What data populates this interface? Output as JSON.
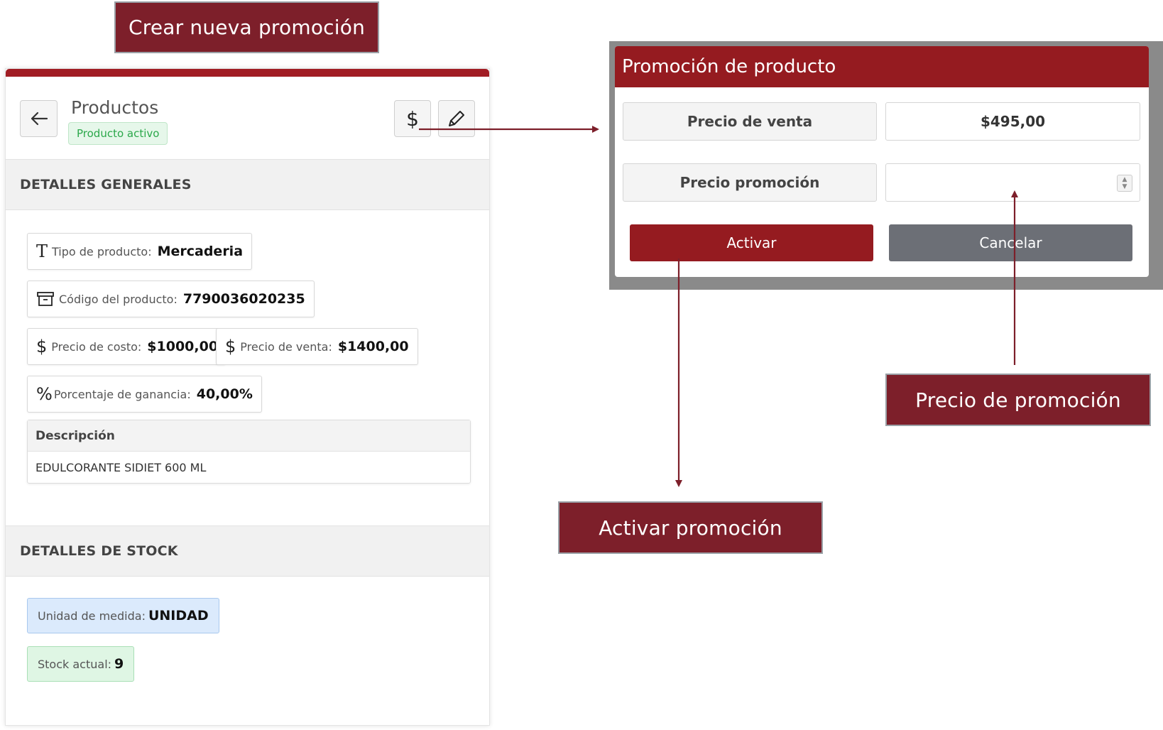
{
  "callouts": {
    "create": "Crear nueva promoción",
    "price": "Precio de promoción",
    "activate": "Activar promoción"
  },
  "colors": {
    "brand": "#951b20",
    "callout": "#7d1f2a",
    "cancel": "#6c6f76"
  },
  "product": {
    "title": "Productos",
    "status_badge": "Producto activo",
    "back_icon": "arrow-left-icon",
    "promo_icon": "dollar-icon",
    "edit_icon": "pencil-icon"
  },
  "general": {
    "heading": "DETALLES GENERALES",
    "tipo_label": "Tipo de producto:",
    "tipo_value": "Mercaderia",
    "codigo_label": "Código del producto:",
    "codigo_value": "7790036020235",
    "costo_label": "Precio de costo:",
    "costo_value": "$1000,00",
    "venta_label": "Precio de venta:",
    "venta_value": "$1400,00",
    "ganancia_label": "Porcentaje de ganancia:",
    "ganancia_value": "40,00%",
    "desc_heading": "Descripción",
    "desc_value": "EDULCORANTE SIDIET 600 ML"
  },
  "stock": {
    "heading": "DETALLES DE STOCK",
    "unidad_label": "Unidad de medida:",
    "unidad_value": "UNIDAD",
    "stock_label": "Stock actual:",
    "stock_value": "9"
  },
  "modal": {
    "title": "Promoción de producto",
    "precio_venta_label": "Precio de venta",
    "precio_venta_value": "$495,00",
    "precio_promo_label": "Precio promoción",
    "precio_promo_value": "",
    "activate_label": "Activar",
    "cancel_label": "Cancelar"
  }
}
